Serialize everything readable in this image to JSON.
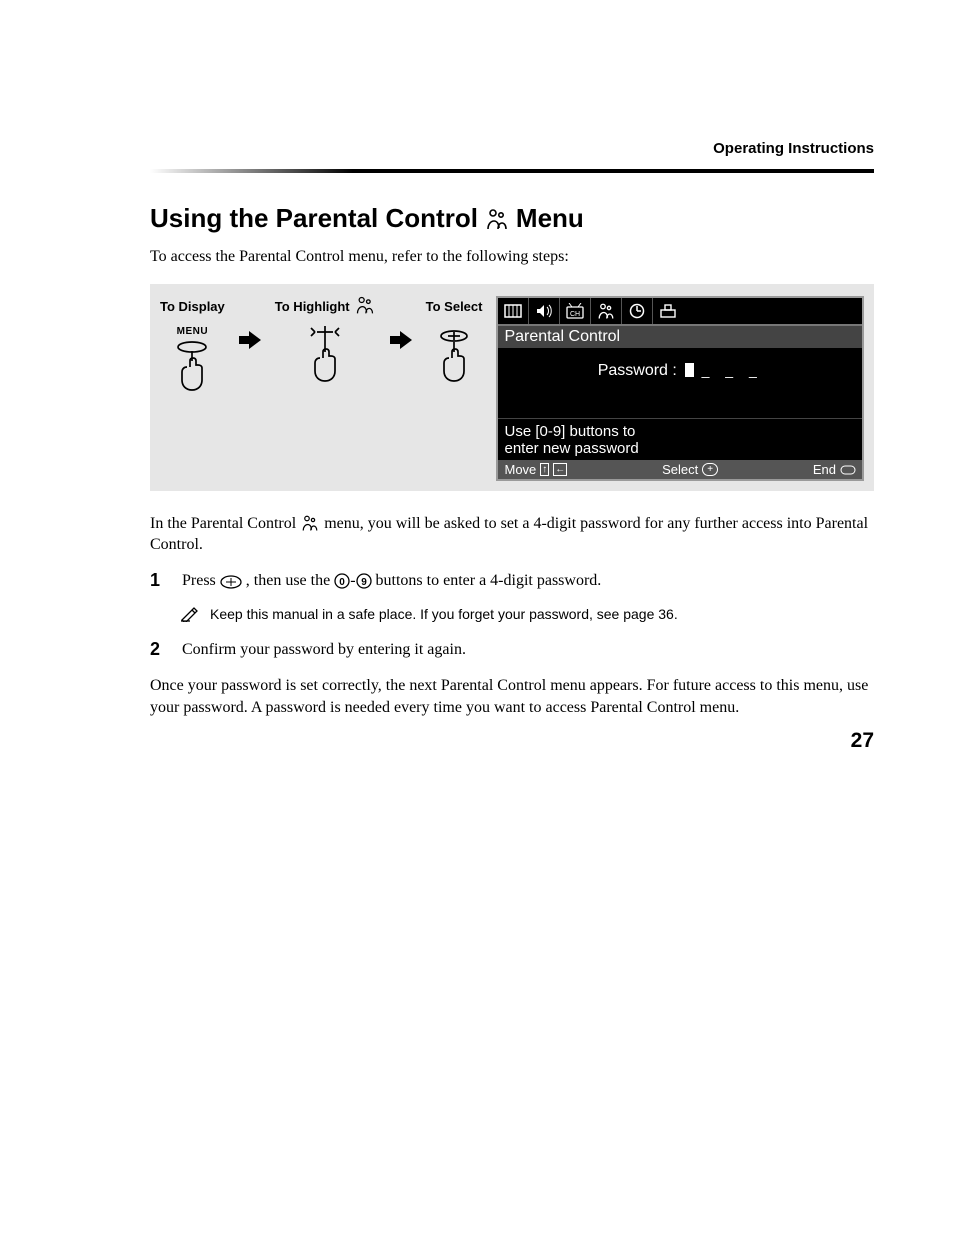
{
  "header_label": "Operating Instructions",
  "title_pre": "Using the Parental Control",
  "title_post": "Menu",
  "intro": "To access the Parental Control menu, refer to the following steps:",
  "columns": {
    "display": "To Display",
    "display_sub": "MENU",
    "highlight": "To Highlight",
    "select": "To Select"
  },
  "osd": {
    "title": "Parental Control",
    "password_label": "Password :",
    "dashes": "_ _ _",
    "msg_line1": "Use [0-9] buttons to",
    "msg_line2": "enter new password",
    "footer_move": "Move",
    "footer_select": "Select",
    "footer_end": "End"
  },
  "after_box": "In the Parental Control ",
  "after_box_2": " menu, you will be asked to set a 4-digit password for any further access into Parental Control.",
  "step1_a": "Press ",
  "step1_b": ", then use the ",
  "step1_c": " buttons to enter a 4-digit password.",
  "note_text": "Keep this manual in a safe place. If you forget your password, see page 36.",
  "step2": "Confirm your password by entering it again.",
  "final_para": "Once your password is set correctly, the next Parental Control menu appears. For future access to this menu, use your password. A password is needed every time you want to access Parental Control menu.",
  "page_number": "27"
}
